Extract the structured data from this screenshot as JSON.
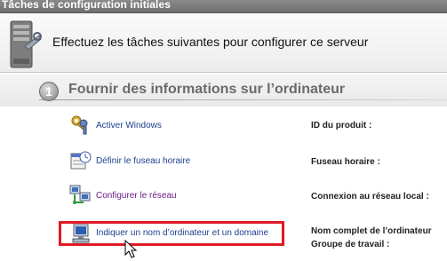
{
  "window": {
    "title": "Tâches de configuration initiales"
  },
  "header": {
    "text": "Effectuez les tâches suivantes pour configurer ce serveur"
  },
  "section": {
    "number": "1",
    "title": "Fournir des informations sur l’ordinateur"
  },
  "tasks": [
    {
      "label": "Activer Windows",
      "icon": "keys-icon"
    },
    {
      "label": "Définir le fuseau horaire",
      "icon": "calendar-clock-icon"
    },
    {
      "label": "Configurer le réseau",
      "icon": "network-icon"
    },
    {
      "label": "Indiquer un nom d’ordinateur et un domaine",
      "icon": "computer-icon"
    }
  ],
  "info_labels": [
    "ID du produit :",
    "Fuseau horaire :",
    "Connexion au réseau local :",
    "Nom complet de l’ordinateur",
    "Groupe de travail :"
  ],
  "colors": {
    "highlight": "#e01b24",
    "link": "#1c3f8f",
    "visited_link": "#6b1e86"
  }
}
